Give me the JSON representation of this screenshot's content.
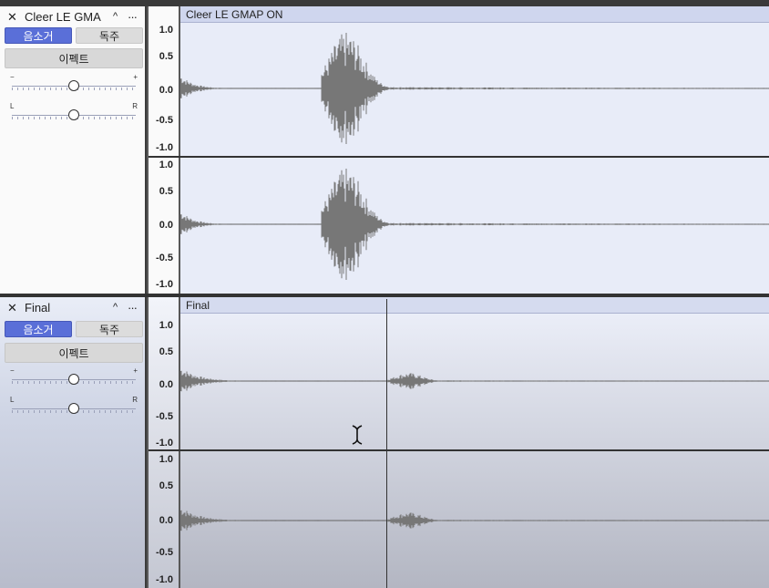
{
  "tracks": [
    {
      "name": "Cleer LE GMA",
      "clip_title": "Cleer LE GMAP ON",
      "mute_label": "음소거",
      "solo_label": "독주",
      "effects_label": "이펙트",
      "gain_minus": "−",
      "gain_plus": "+",
      "pan_left": "L",
      "pan_right": "R",
      "collapse_glyph": "^",
      "menu_glyph": "···",
      "close_glyph": "✕"
    },
    {
      "name": "Final",
      "clip_title": "Final",
      "mute_label": "음소거",
      "solo_label": "독주",
      "effects_label": "이펙트",
      "gain_minus": "−",
      "gain_plus": "+",
      "pan_left": "L",
      "pan_right": "R",
      "collapse_glyph": "^",
      "menu_glyph": "···",
      "close_glyph": "✕"
    }
  ],
  "amplitude_ticks": [
    "1.0",
    "0.5",
    "0.0",
    "-0.5",
    "-1.0"
  ],
  "colors": {
    "mute_active": "#5a6fd8",
    "waveform": "#777777",
    "clip_background": "#e8ecf8"
  },
  "icons": [
    "close-icon",
    "collapse-caret-icon",
    "track-menu-icon",
    "ibeam-cursor-icon"
  ]
}
